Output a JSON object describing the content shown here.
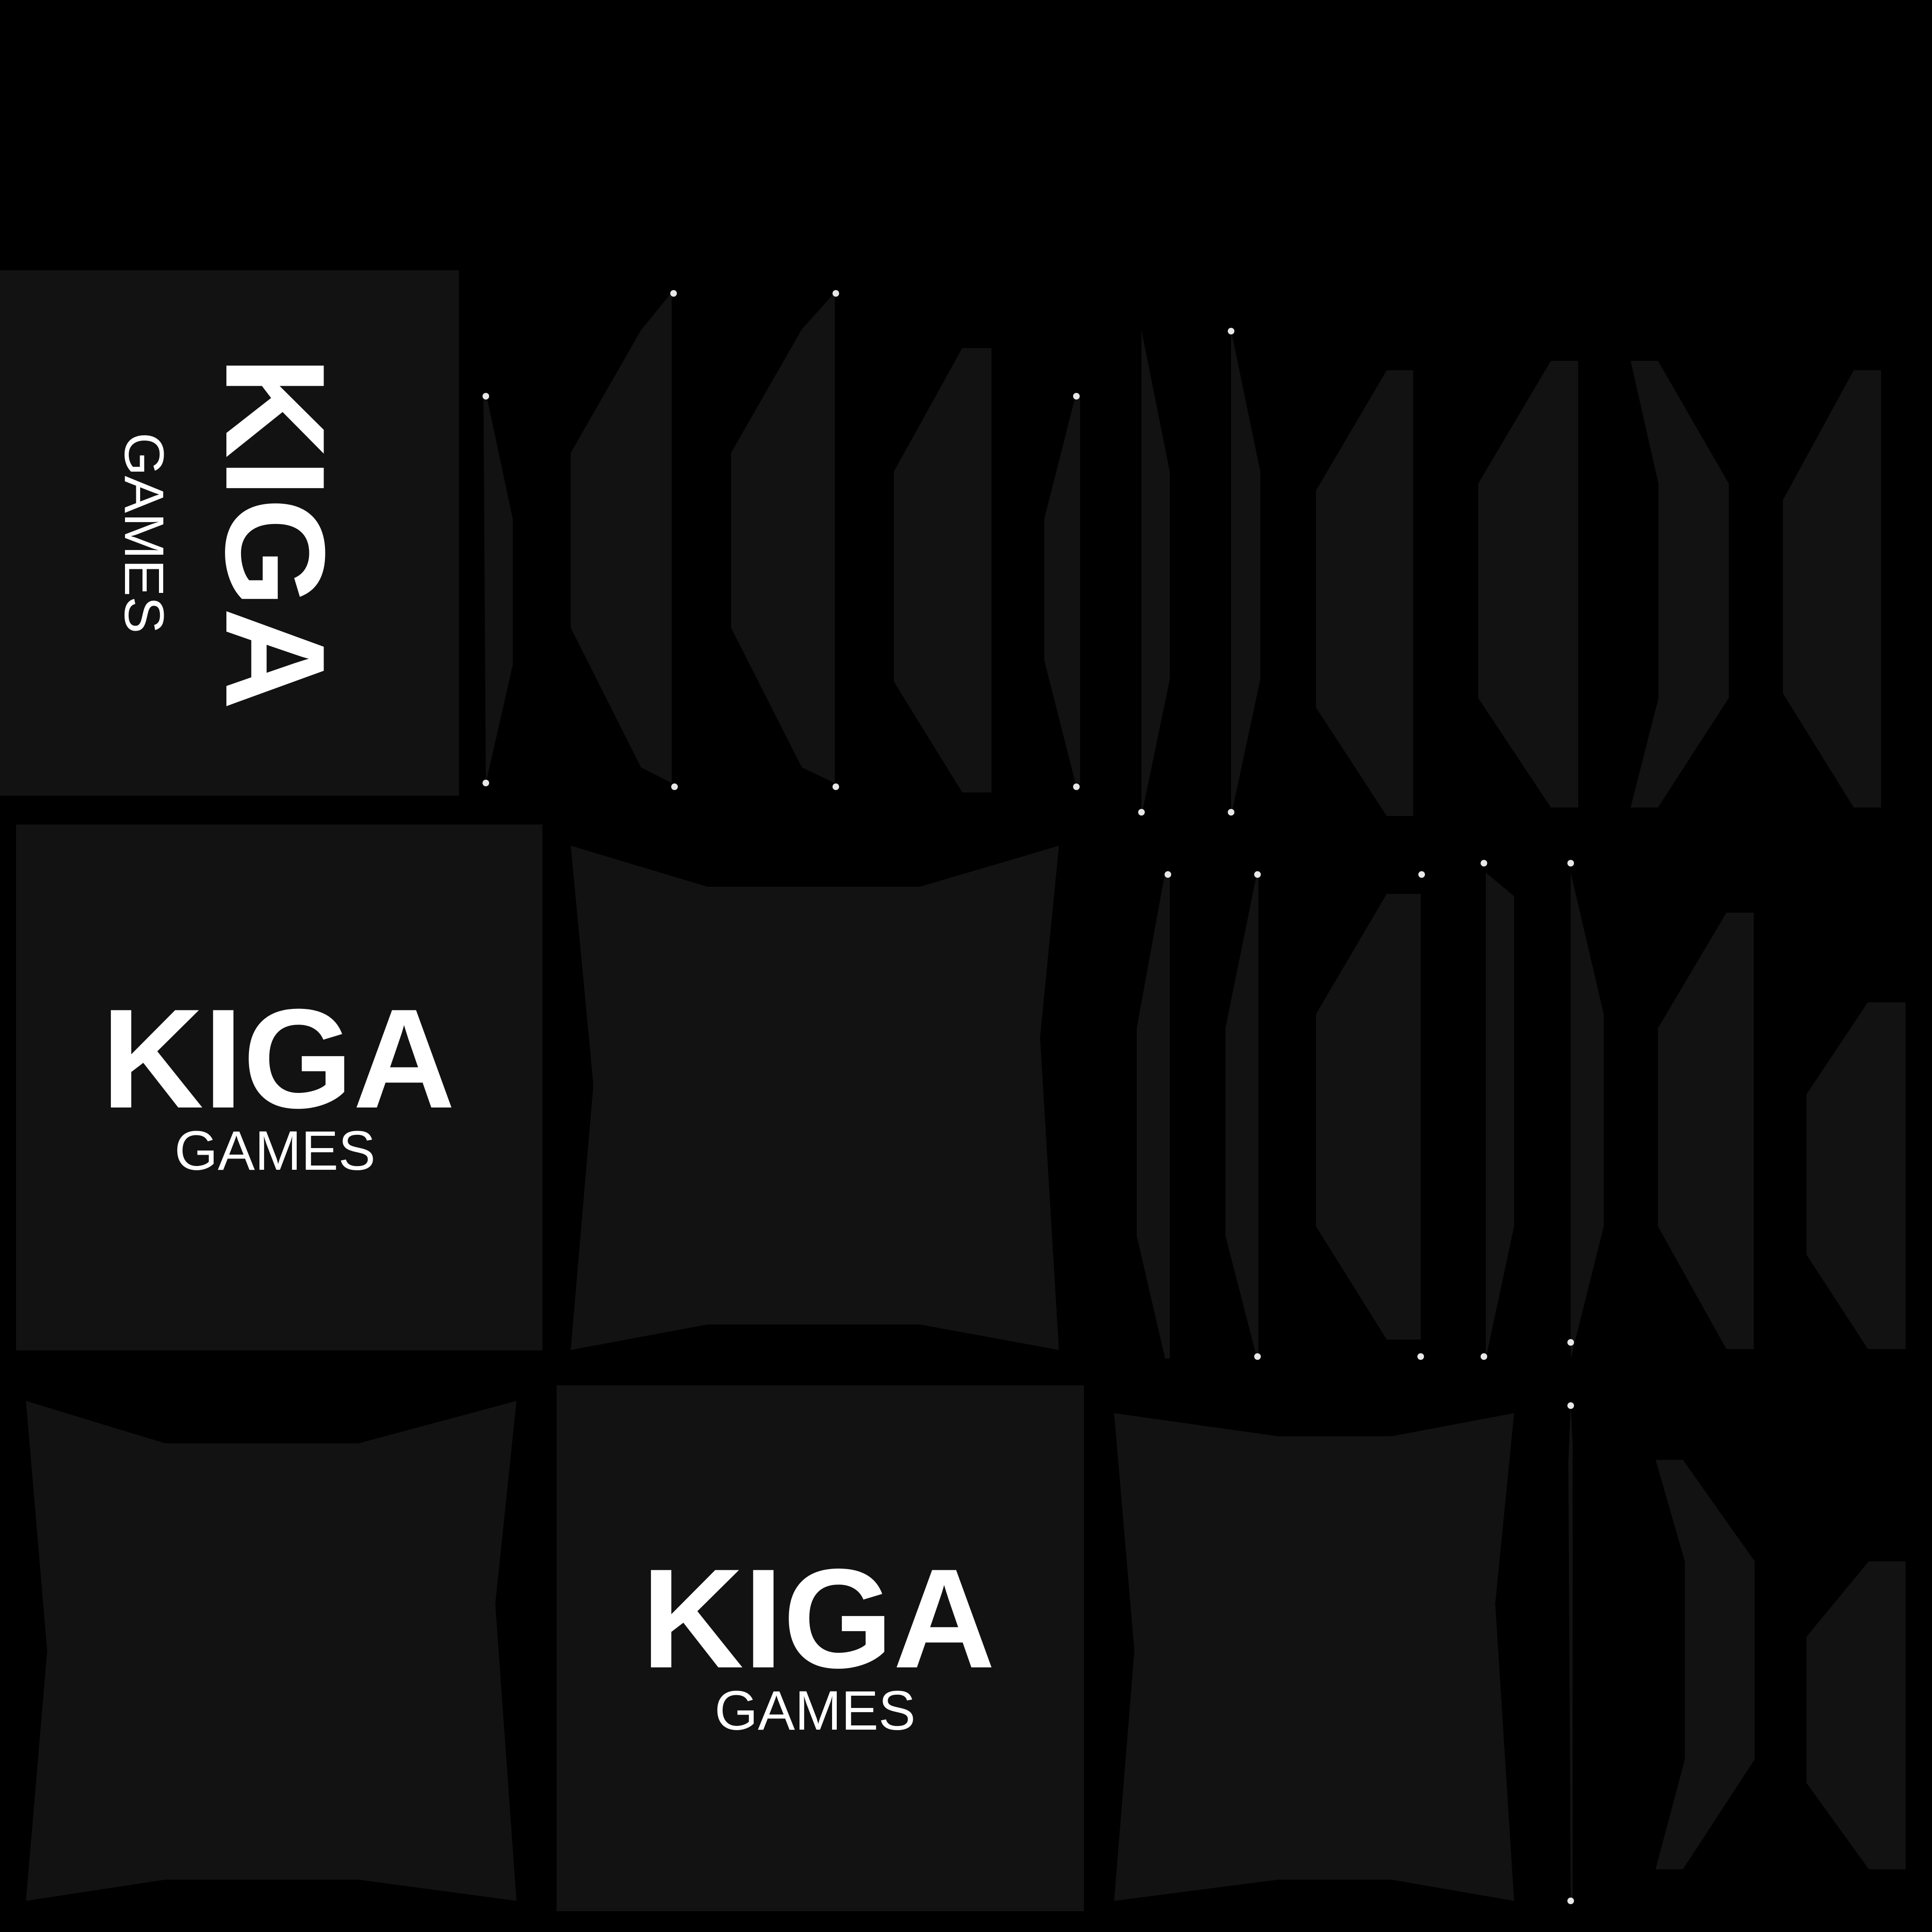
{
  "texture_atlas": {
    "background_color": "#000000",
    "panel_color": "#121212",
    "logo_text_color": "#ffffff",
    "logos": [
      {
        "id": "logo-rotated",
        "wordmark": "KIGA",
        "subtitle": "GAMES",
        "orientation": "rotated"
      },
      {
        "id": "logo-middle",
        "wordmark": "KIGA",
        "subtitle": "GAMES",
        "orientation": "upright"
      },
      {
        "id": "logo-bottom",
        "wordmark": "KIGA",
        "subtitle": "GAMES",
        "orientation": "upright"
      }
    ]
  }
}
